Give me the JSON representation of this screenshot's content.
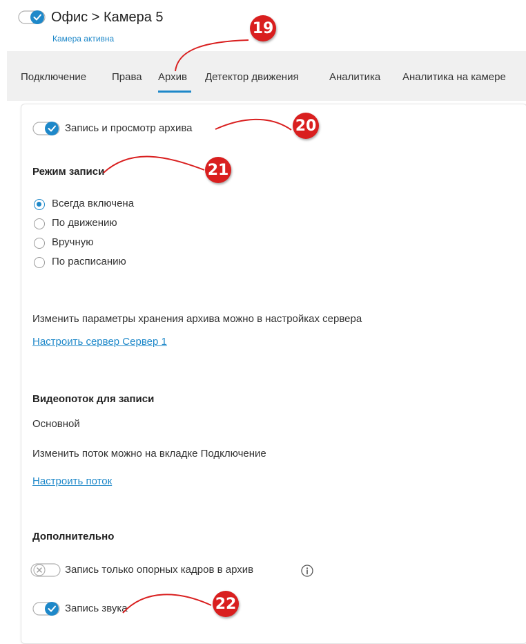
{
  "header": {
    "title": "Офис > Камера 5",
    "status": "Камера активна"
  },
  "tabs": [
    {
      "label": "Подключение"
    },
    {
      "label": "Права"
    },
    {
      "label": "Архив",
      "active": true
    },
    {
      "label": "Детектор движения"
    },
    {
      "label": "Аналитика"
    },
    {
      "label": "Аналитика на камере"
    }
  ],
  "archive": {
    "record_toggle_label": "Запись и просмотр архива",
    "record_mode_heading": "Режим записи",
    "record_modes": [
      {
        "label": "Всегда включена",
        "selected": true
      },
      {
        "label": "По движению",
        "selected": false
      },
      {
        "label": "Вручную",
        "selected": false
      },
      {
        "label": "По расписанию",
        "selected": false
      }
    ],
    "storage_text": "Изменить параметры хранения архива можно в настройках сервера",
    "server_link": "Настроить сервер Сервер 1",
    "stream_heading": "Видеопоток для записи",
    "stream_value": "Основной",
    "stream_change_text": "Изменить поток можно на вкладке Подключение",
    "stream_link": "Настроить поток",
    "additional_heading": "Дополнительно",
    "keyframes_label": "Запись только опорных кадров в архив",
    "audio_label": "Запись звука"
  },
  "markers": [
    "19",
    "20",
    "21",
    "22"
  ],
  "colors": {
    "accent": "#1e88c9",
    "marker": "#d91f1f",
    "tabbar": "#f0f0f0"
  },
  "icons": [
    "check-icon",
    "info-icon",
    "x-icon"
  ]
}
